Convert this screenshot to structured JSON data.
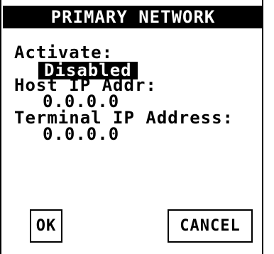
{
  "header": {
    "title": "PRIMARY NETWORK"
  },
  "form": {
    "activate_label": "Activate:",
    "activate_value": "Disabled",
    "host_ip_label": "Host IP Addr:",
    "host_ip_value": "0.0.0.0",
    "terminal_ip_label": "Terminal IP Address:",
    "terminal_ip_value": "0.0.0.0"
  },
  "buttons": {
    "ok_label": "OK",
    "cancel_label": "CANCEL"
  },
  "colors": {
    "background": "#ffffff",
    "foreground": "#000000",
    "highlight_bg": "#000000",
    "highlight_fg": "#ffffff"
  }
}
